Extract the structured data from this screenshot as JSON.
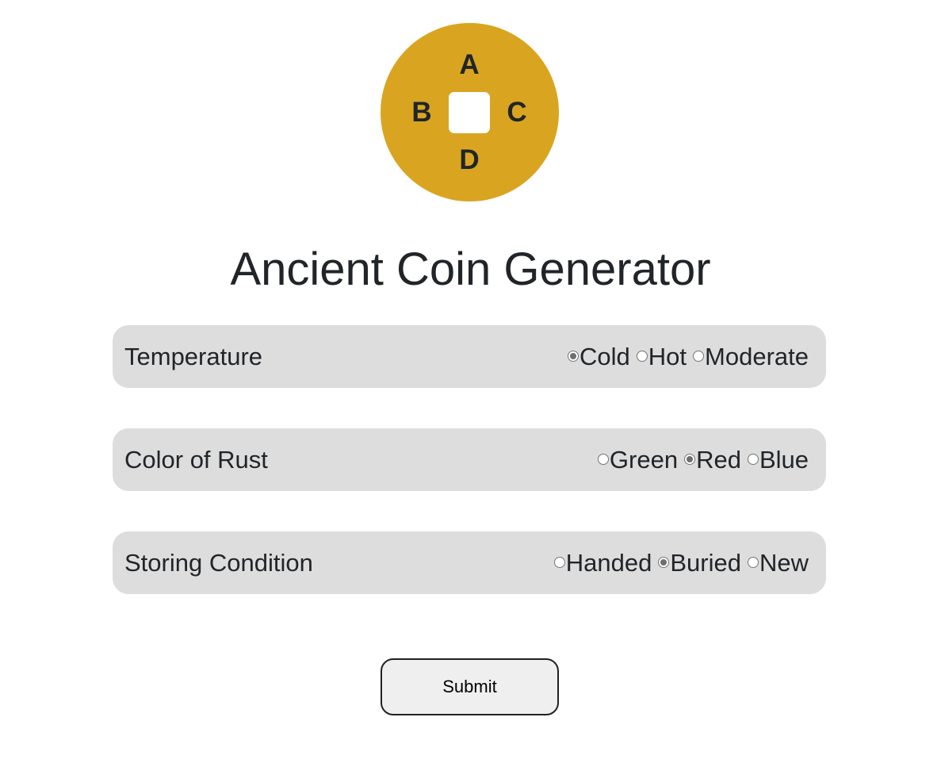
{
  "coin": {
    "top_letter": "A",
    "left_letter": "B",
    "right_letter": "C",
    "bottom_letter": "D",
    "color": "#d9a521"
  },
  "page": {
    "title": "Ancient Coin Generator"
  },
  "temperature": {
    "label": "Temperature",
    "options": [
      {
        "label": "Cold",
        "checked": true
      },
      {
        "label": "Hot",
        "checked": false
      },
      {
        "label": "Moderate",
        "checked": false
      }
    ]
  },
  "rust": {
    "label": "Color of Rust",
    "options": [
      {
        "label": "Green",
        "checked": false
      },
      {
        "label": "Red",
        "checked": true
      },
      {
        "label": "Blue",
        "checked": false
      }
    ]
  },
  "storage": {
    "label": "Storing Condition",
    "options": [
      {
        "label": "Handed",
        "checked": false
      },
      {
        "label": "Buried",
        "checked": true
      },
      {
        "label": "New",
        "checked": false
      }
    ]
  },
  "form": {
    "submit_label": "Submit"
  }
}
